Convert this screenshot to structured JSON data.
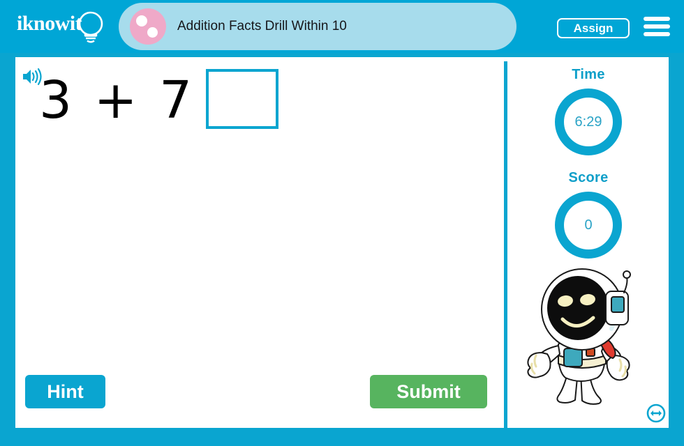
{
  "header": {
    "logo_text": "iknowit",
    "logo_icon": "lightbulb-icon",
    "title": "Addition Facts Drill Within 10",
    "title_icon": "pink-circle-dots-icon",
    "assign_label": "Assign",
    "menu_icon": "hamburger-menu-icon",
    "bg_color": "#00a6d6",
    "titlebar_color": "#a7dcec",
    "title_dot_color": "#efa9c8"
  },
  "problem": {
    "speaker_icon": "speaker-audio-icon",
    "equation": "3 + 7 =",
    "answer_value": "",
    "answer_placeholder": ""
  },
  "actions": {
    "hint_label": "Hint",
    "hint_color": "#0aa5d0",
    "submit_label": "Submit",
    "submit_color": "#57b45f"
  },
  "sidebar": {
    "time": {
      "label": "Time",
      "value": "6:29"
    },
    "score": {
      "label": "Score",
      "value": "0"
    },
    "mascot": "astronaut-mascot",
    "resize_icon": "resize-horizontal-icon",
    "accent_color": "#0aa5d0"
  }
}
